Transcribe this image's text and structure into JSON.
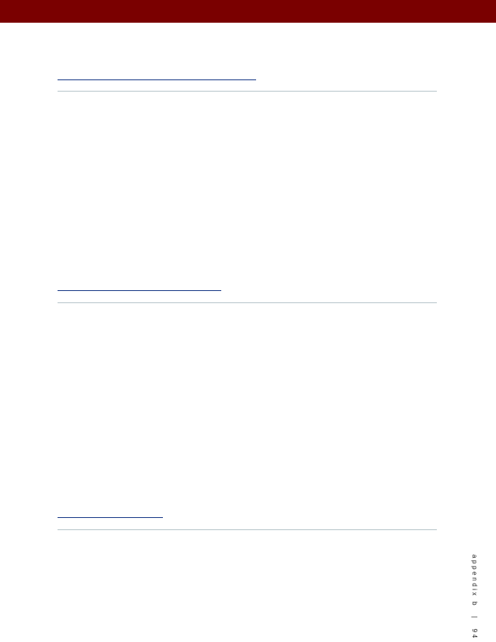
{
  "colors": {
    "header_band": "#7a0000",
    "link_underline": "#1f3f8a",
    "section_rule": "#b9c7cc"
  },
  "footer": {
    "section_label": "appendix b",
    "separator": "|",
    "page_number": "94"
  }
}
